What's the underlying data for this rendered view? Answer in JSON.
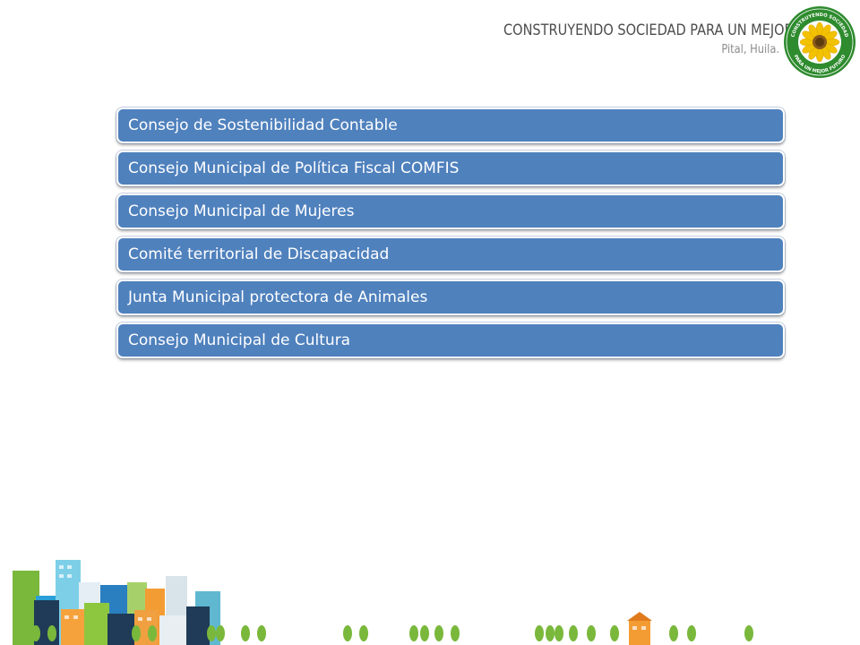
{
  "header": {
    "title": "CONSTRUYENDO SOCIEDAD PARA UN MEJOR FUTURO",
    "subtitle": "Pital, Huila.",
    "seal_top_text": "CONSTRUYENDO SOCIEDAD",
    "seal_bottom_text": "PARA UN MEJOR FUTURO"
  },
  "items": [
    {
      "label": "Consejo de Sostenibilidad Contable"
    },
    {
      "label": "Consejo Municipal de Política Fiscal COMFIS"
    },
    {
      "label": "Consejo Municipal de Mujeres"
    },
    {
      "label": "Comité territorial de Discapacidad"
    },
    {
      "label": "Junta Municipal protectora de Animales"
    },
    {
      "label": "Consejo Municipal de Cultura"
    }
  ],
  "colors": {
    "item_fill": "#4f81bd",
    "seal_green": "#2e8b2e",
    "sunflower": "#f2c200",
    "tree_green": "#7ab83c"
  },
  "icons": [
    "sunflower-seal-logo",
    "city-skyline-illustration"
  ]
}
